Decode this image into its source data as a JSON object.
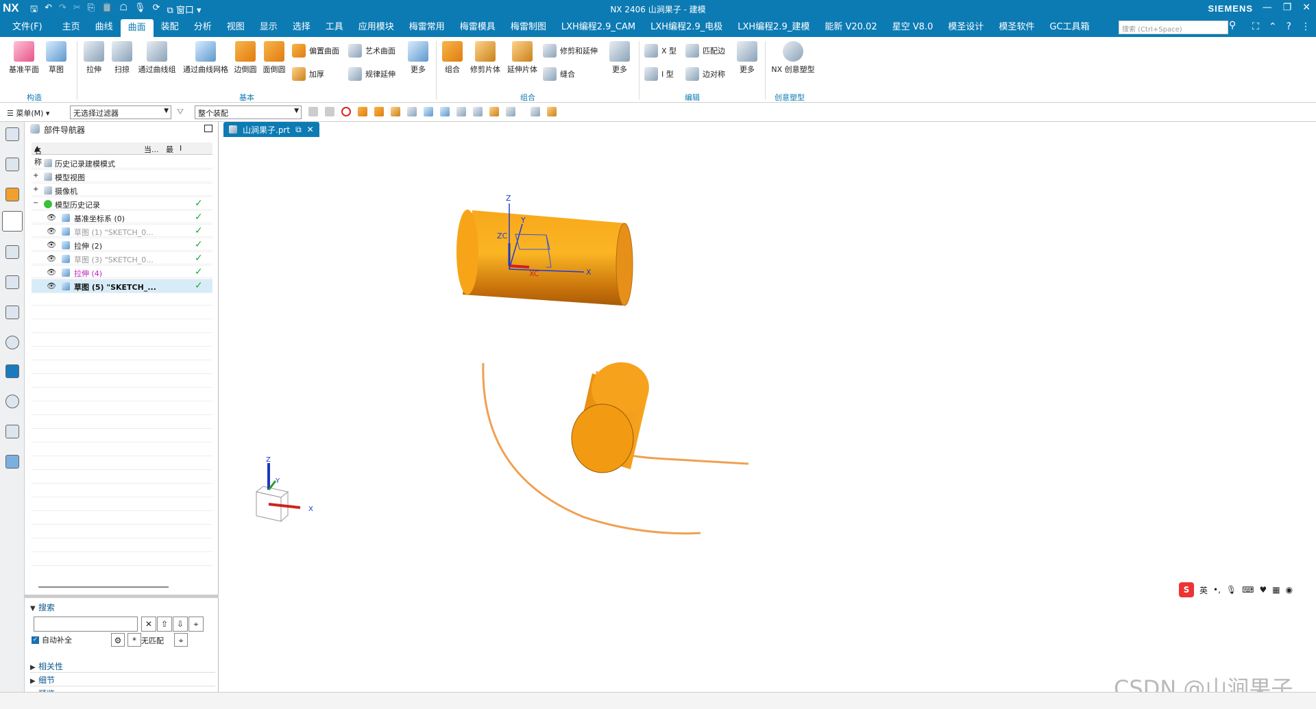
{
  "title_bar": {
    "logo": "NX",
    "title": "NX 2406 山涧果子 - 建模",
    "brand": "SIEMENS",
    "window_menu": "窗口",
    "controls": [
      "minimize-icon",
      "restore-icon",
      "close-icon"
    ]
  },
  "menu": {
    "items": [
      "文件(F)",
      "主页",
      "曲线",
      "曲面",
      "装配",
      "分析",
      "视图",
      "显示",
      "选择",
      "工具",
      "应用模块",
      "梅雷常用",
      "梅雷模具",
      "梅雷制图",
      "LXH编程2.9_CAM",
      "LXH编程2.9_电极",
      "LXH编程2.9_建模",
      "能新 V20.02",
      "星空 V8.0",
      "模圣设计",
      "模圣软件",
      "GC工具箱"
    ],
    "active_index": 3,
    "search_placeholder": "搜索 (Ctrl+Space)"
  },
  "ribbon": {
    "construct": {
      "label": "构造",
      "buttons": [
        "基准平面",
        "草图"
      ]
    },
    "basic": {
      "label": "基本",
      "buttons": [
        "拉伸",
        "扫掠",
        "通过曲线组",
        "通过曲线网格",
        "边倒圆",
        "面倒圆"
      ],
      "small": [
        "偏置曲面",
        "加厚",
        "艺术曲面",
        "规律延伸"
      ],
      "more": "更多"
    },
    "combine": {
      "label": "组合",
      "buttons": [
        "组合",
        "修剪片体",
        "延伸片体"
      ],
      "small": [
        "修剪和延伸",
        "缝合"
      ],
      "more": "更多"
    },
    "edit": {
      "label": "编辑",
      "small": [
        "X 型",
        "I 型",
        "匹配边",
        "边对称"
      ],
      "more": "更多"
    },
    "creative": {
      "label": "创意塑型",
      "buttons": [
        "NX 创意塑型"
      ]
    }
  },
  "toolbar": {
    "menu_label": "菜单(M)",
    "filter_value": "无选择过滤器",
    "scope_value": "整个装配"
  },
  "navigator": {
    "title": "部件导航器",
    "columns": [
      "名称",
      "当...",
      "最",
      "I"
    ],
    "rows": [
      {
        "label": "历史记录建模模式",
        "style": "normal",
        "check": false
      },
      {
        "label": "模型视图",
        "style": "normal",
        "check": false
      },
      {
        "label": "摄像机",
        "style": "normal",
        "check": false
      },
      {
        "label": "模型历史记录",
        "style": "normal",
        "check": true
      },
      {
        "label": "基准坐标系 (0)",
        "style": "normal",
        "check": true
      },
      {
        "label": "草图 (1) \"SKETCH_0...",
        "style": "dim",
        "check": true
      },
      {
        "label": "拉伸 (2)",
        "style": "normal",
        "check": true
      },
      {
        "label": "草图 (3) \"SKETCH_0...",
        "style": "dim",
        "check": true
      },
      {
        "label": "拉伸 (4)",
        "style": "magenta",
        "check": true
      },
      {
        "label": "草图 (5) \"SKETCH_...",
        "style": "bold",
        "check": true
      }
    ],
    "check_mark": "✓",
    "search_label": "搜索",
    "auto_complete_label": "自动补全",
    "no_match_label": "无匹配",
    "sections": [
      "相关性",
      "细节",
      "预览"
    ]
  },
  "document_tab": {
    "label": "山涧果子.prt"
  },
  "viewport": {
    "axis_labels": {
      "z": "Z",
      "y": "Y",
      "x": "X",
      "zc": "ZC",
      "xc": "XC"
    },
    "body_color": "#f5a011",
    "curve_color": "#f0a050"
  },
  "ime": {
    "logo": "S",
    "lang": "英"
  },
  "watermark": "CSDN @山涧果子"
}
